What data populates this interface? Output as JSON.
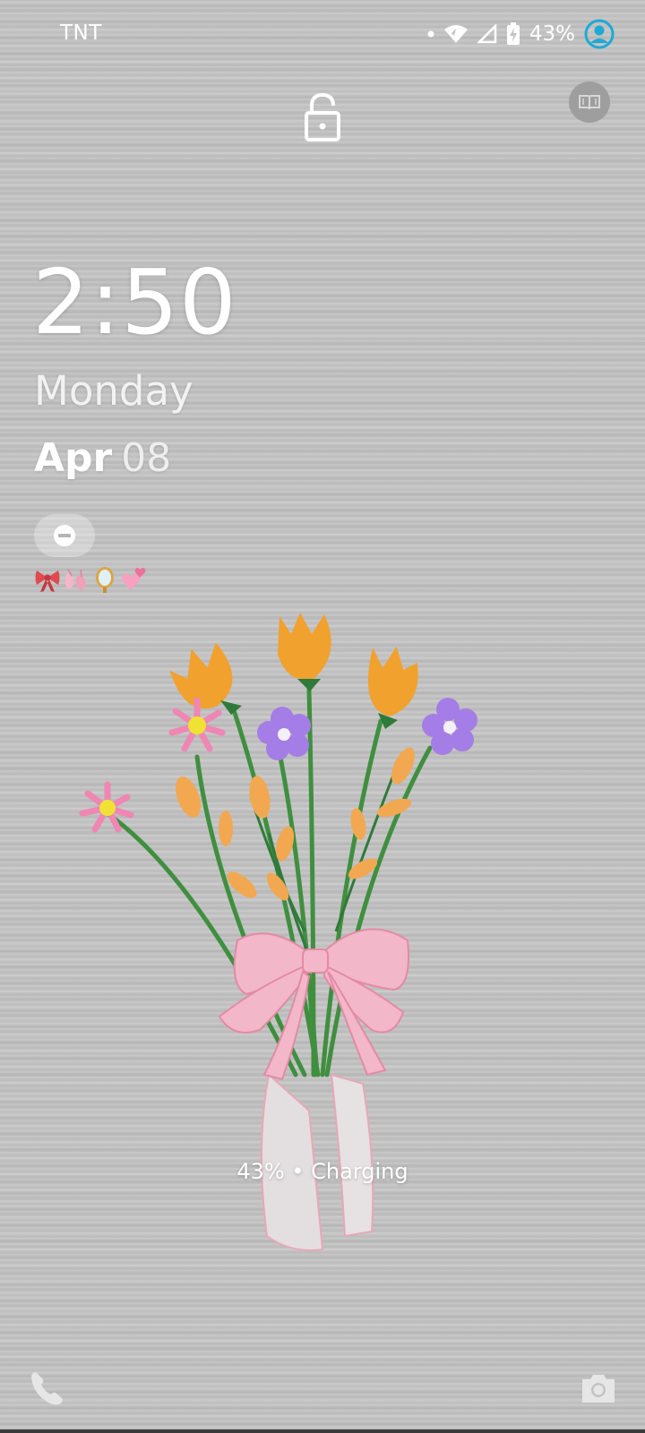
{
  "status_bar": {
    "carrier": "TNT",
    "battery_percent": "43%",
    "icons": [
      "notification-dot-icon",
      "wifi-icon",
      "cellular-signal-icon",
      "battery-charging-icon",
      "account-icon"
    ]
  },
  "lock_screen": {
    "lock_icon": "lock-open-icon",
    "shortcut_top_right_icon": "book-icon",
    "time": "2:50",
    "weekday": "Monday",
    "date_month": "Apr",
    "date_day": "08",
    "dnd_icon": "do-not-disturb-icon",
    "emoji_status": [
      "🎀",
      "🩰",
      "🪞",
      "💞"
    ],
    "charging_status": "43% • Charging",
    "left_shortcut_icon": "phone-icon",
    "right_shortcut_icon": "camera-icon"
  },
  "colors": {
    "wallpaper": "#c3c3c3",
    "text": "#ffffff",
    "account_accent": "#1ea9d6",
    "tulip": "#f1a12e",
    "violet_flower": "#a57de6",
    "pink_flower": "#ef86b4",
    "ribbon": "#f2b7c8"
  }
}
